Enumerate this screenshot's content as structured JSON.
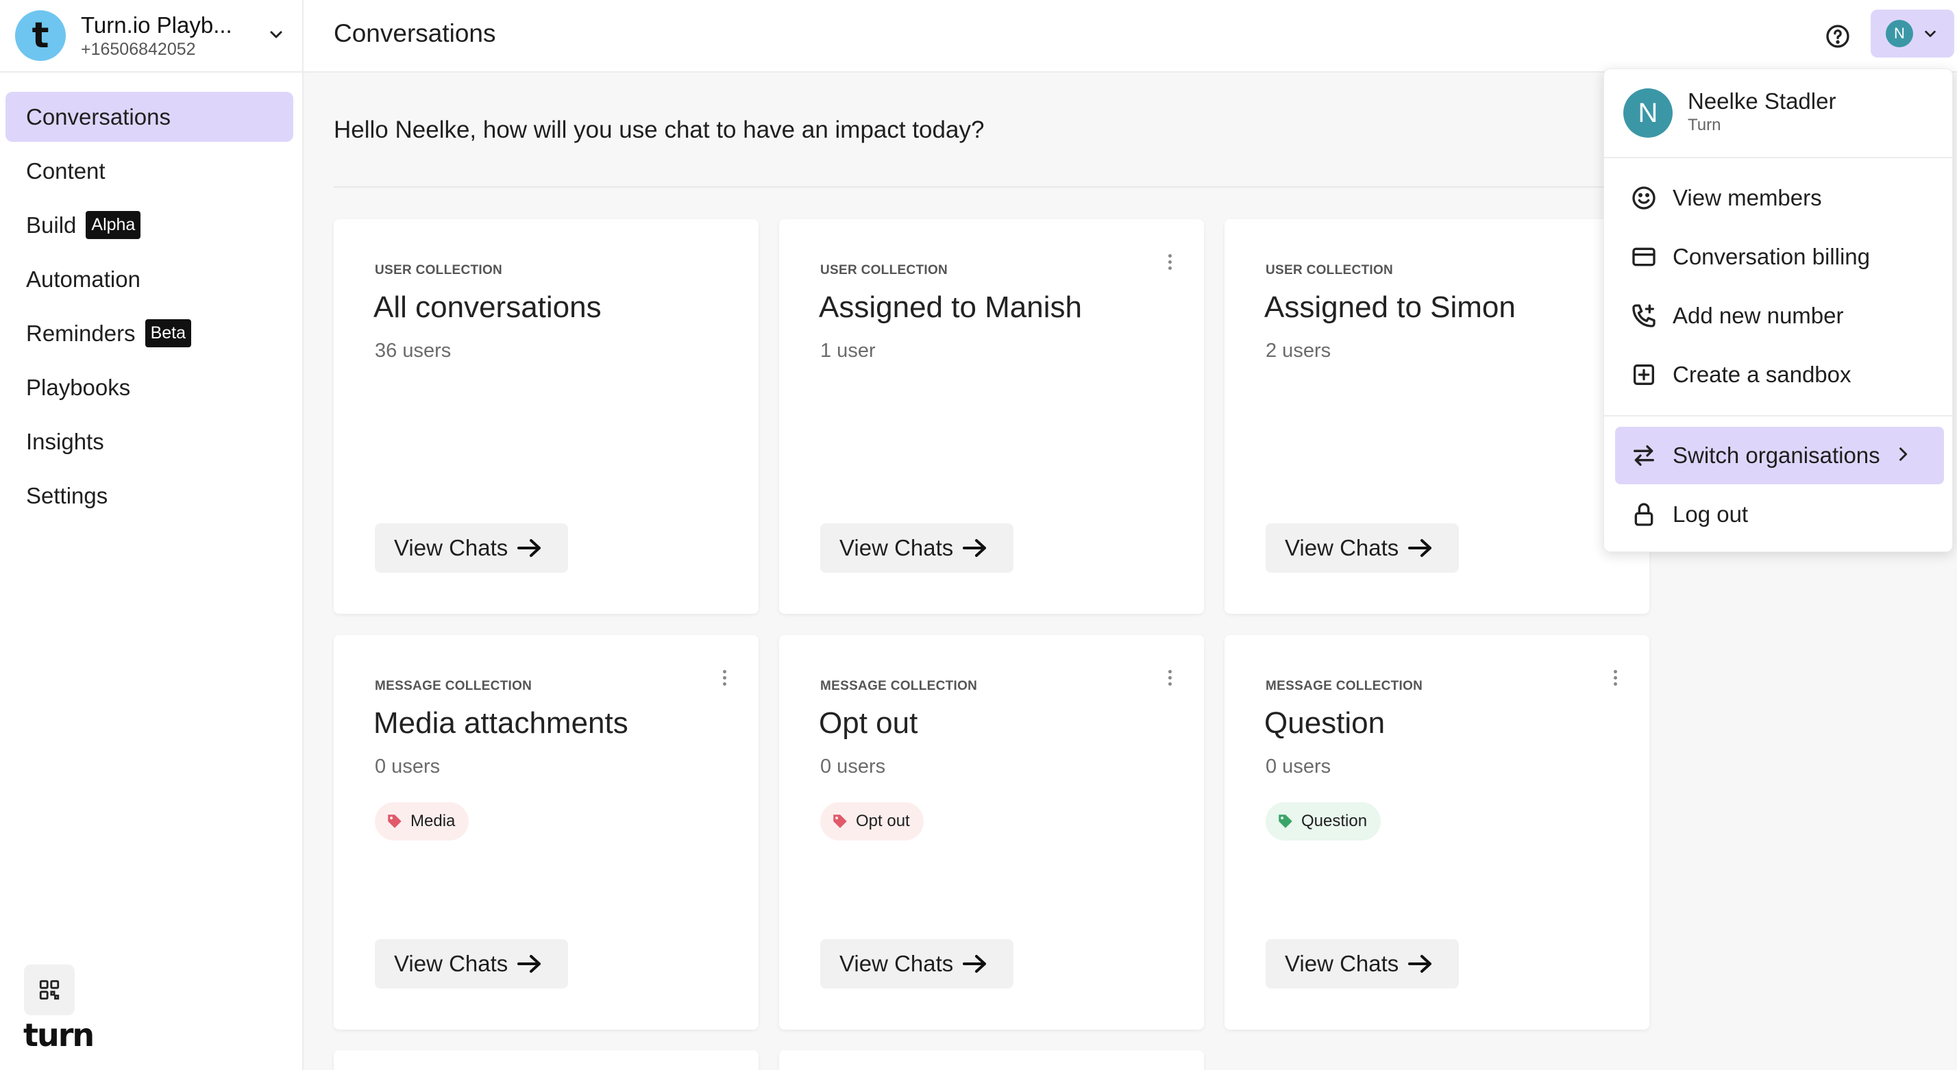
{
  "org": {
    "logo_letter": "t",
    "name": "Turn.io Playb...",
    "phone": "+16506842052"
  },
  "nav": {
    "conversations": "Conversations",
    "content": "Content",
    "build": "Build",
    "build_badge": "Alpha",
    "automation": "Automation",
    "reminders": "Reminders",
    "reminders_badge": "Beta",
    "playbooks": "Playbooks",
    "insights": "Insights",
    "settings": "Settings"
  },
  "brand": "turn",
  "header": {
    "title": "Conversations",
    "avatar_letter": "N"
  },
  "greeting": "Hello Neelke, how will you use chat to have an impact today?",
  "cards": [
    {
      "kind": "USER COLLECTION",
      "title": "All conversations",
      "count": "36 users",
      "button": "View Chats"
    },
    {
      "kind": "USER COLLECTION",
      "title": "Assigned to Manish",
      "count": "1 user",
      "button": "View Chats"
    },
    {
      "kind": "USER COLLECTION",
      "title": "Assigned to Simon",
      "count": "2 users",
      "button": "View Chats"
    },
    {
      "kind": "MESSAGE COLLECTION",
      "title": "Media attachments",
      "count": "0 users",
      "tag": "Media",
      "button": "View Chats"
    },
    {
      "kind": "MESSAGE COLLECTION",
      "title": "Opt out",
      "count": "0 users",
      "tag": "Opt out",
      "button": "View Chats"
    },
    {
      "kind": "MESSAGE COLLECTION",
      "title": "Question",
      "count": "0 users",
      "tag": "Question",
      "button": "View Chats"
    }
  ],
  "colors": {
    "accent": "#ded6fa",
    "avatar": "#3b97a6",
    "tag_red": "#e05a6a",
    "tag_green": "#3aa568",
    "org_logo": "#6ec5f0"
  },
  "dropdown": {
    "avatar_letter": "N",
    "name": "Neelke Stadler",
    "org": "Turn",
    "items": {
      "view_members": "View members",
      "billing": "Conversation billing",
      "add_number": "Add new number",
      "sandbox": "Create a sandbox",
      "switch_orgs": "Switch organisations",
      "logout": "Log out"
    }
  }
}
